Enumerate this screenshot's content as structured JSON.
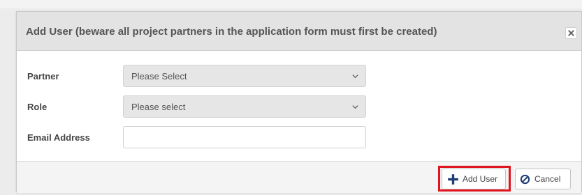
{
  "dialog": {
    "title": "Add User (beware all project partners in the application form must first be created)",
    "close_icon": "close-icon"
  },
  "form": {
    "partner": {
      "label": "Partner",
      "value": "Please Select"
    },
    "role": {
      "label": "Role",
      "value": "Please select"
    },
    "email": {
      "label": "Email Address",
      "value": "",
      "placeholder": ""
    }
  },
  "footer": {
    "add_user_label": "Add User",
    "add_user_icon": "plus-icon",
    "cancel_label": "Cancel",
    "cancel_icon": "ban-icon"
  },
  "colors": {
    "header_bg": "#e3e3e3",
    "select_bg": "#e6e6e6",
    "icon_blue": "#1f3e77",
    "highlight_red": "#e0141e"
  }
}
